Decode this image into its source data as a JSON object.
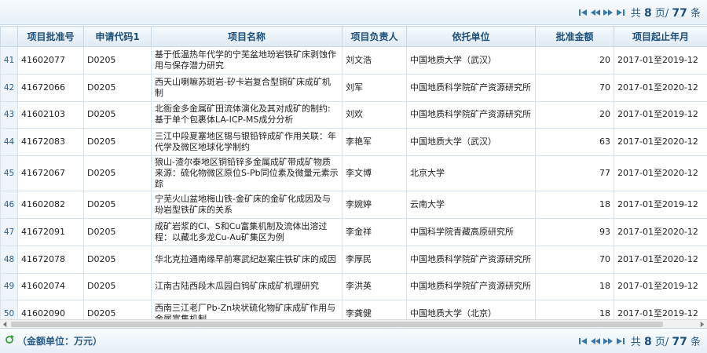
{
  "pager": {
    "first_icon": "first-page-icon",
    "prev_icon": "prev-page-icon",
    "next_icon": "next-page-icon",
    "last_icon": "last-page-icon",
    "prefix": "共",
    "pages": "8",
    "pages_suffix": "页/",
    "total": "77",
    "total_suffix": "条",
    "accent": "#2b5d88"
  },
  "footer": {
    "unit_note": "（金额单位：万元）",
    "icon": "refresh-icon"
  },
  "table": {
    "columns": [
      "项目批准号",
      "申请代码1",
      "项目名称",
      "项目负责人",
      "依托单位",
      "批准金额",
      "项目起止年月"
    ],
    "rows": [
      {
        "n": "41",
        "id": "41602077",
        "code": "D0205",
        "name": "基于低温热年代学的宁芜盆地玢岩铁矿床剥蚀作用与保存潜力研究",
        "pi": "刘文浩",
        "org": "中国地质大学（武汉）",
        "amount": "20",
        "period": "2017-01至2019-12"
      },
      {
        "n": "42",
        "id": "41672066",
        "code": "D0205",
        "name": "西天山喇嘛苏斑岩-矽卡岩复合型铜矿床成矿机制",
        "pi": "刘军",
        "org": "中国地质科学院矿产资源研究所",
        "amount": "70",
        "period": "2017-01至2020-12"
      },
      {
        "n": "43",
        "id": "41602103",
        "code": "D0205",
        "name": "北衙金多金属矿田流体演化及其对成矿的制约:基于单个包裹体LA-ICP-MS成分分析",
        "pi": "刘欢",
        "org": "中国地质科学院矿产资源研究所",
        "amount": "20",
        "period": "2017-01至2019-12"
      },
      {
        "n": "44",
        "id": "41672083",
        "code": "D0205",
        "name": "三江中段夏塞地区锡与银铅锌成矿作用关联：年代学及微区地球化学制约",
        "pi": "李艳军",
        "org": "中国地质大学（武汉）",
        "amount": "63",
        "period": "2017-01至2020-12"
      },
      {
        "n": "45",
        "id": "41672067",
        "code": "D0205",
        "name": "狼山-渣尔泰地区铜铅锌多金属成矿带成矿物质来源：硫化物微区原位S-Pb同位素及微量元素示踪",
        "pi": "李文博",
        "org": "北京大学",
        "amount": "77",
        "period": "2017-01至2020-12"
      },
      {
        "n": "46",
        "id": "41602082",
        "code": "D0205",
        "name": "宁芜火山盆地梅山铁-金矿床的金矿化成因及与玢岩型铁矿床的关系",
        "pi": "李婉婷",
        "org": "云南大学",
        "amount": "18",
        "period": "2017-01至2019-12"
      },
      {
        "n": "47",
        "id": "41672091",
        "code": "D0205",
        "name": "成矿岩浆的Cl、S和Cu富集机制及流体出溶过程：以藏北多龙Cu-Au矿集区为例",
        "pi": "李金祥",
        "org": "中国科学院青藏高原研究所",
        "amount": "93",
        "period": "2017-01至2020-12"
      },
      {
        "n": "48",
        "id": "41672078",
        "code": "D0205",
        "name": "华北克拉通南缘早前寒武纪赵案庄铁矿床的成因",
        "pi": "李厚民",
        "org": "中国地质科学院矿产资源研究所",
        "amount": "70",
        "period": "2017-01至2020-12"
      },
      {
        "n": "49",
        "id": "41602074",
        "code": "D0205",
        "name": "江南古陆西段木瓜园白钨矿床成矿机理研究",
        "pi": "李洪英",
        "org": "中国地质科学院矿产资源研究所",
        "amount": "18",
        "period": "2017-01至2019-12"
      },
      {
        "n": "50",
        "id": "41602090",
        "code": "D0205",
        "name": "西南三江老厂Pb-Zn块状硫化物矿床成矿作用与金属富集机制",
        "pi": "李龚健",
        "org": "中国地质大学（北京）",
        "amount": "18",
        "period": "2017-01至2019-12"
      }
    ]
  }
}
